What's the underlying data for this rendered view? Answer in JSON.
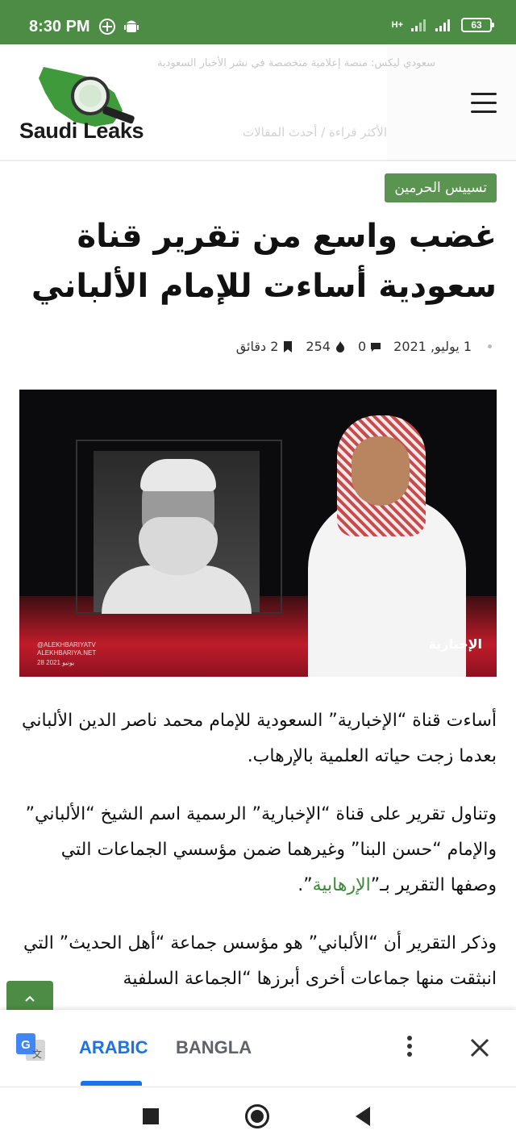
{
  "status_bar": {
    "time": "8:30 PM",
    "network_label": "H+",
    "battery": "63"
  },
  "header": {
    "logo_text": "Saudi Leaks",
    "faded_top_text": "سعودي ليكس: منصة إعلامية متخصصة في نشر الأخبار السعودية",
    "faded_bottom_text": "الأكثر قراءة / أحدث المقالات"
  },
  "article": {
    "category": "تسييس الحرمين",
    "title": "غضب واسع من تقرير قناة سعودية أساءت للإمام الألباني",
    "meta": {
      "date": "1 يوليو, 2021",
      "comments": "0",
      "views": "254",
      "read_time": "2 دقائق"
    },
    "hero_image": {
      "watermark_handle": "@ALEKHBARIYATV",
      "watermark_site": "ALEKHBARIYA.NET",
      "watermark_date": "28 يونيو 2021",
      "channel_logo": "الإخبارية"
    },
    "paragraphs": [
      "أساءت قناة “الإخبارية” السعودية للإمام محمد ناصر الدين الألباني بعدما زجت حياته العلمية بالإرهاب.",
      "وتناول تقرير على قناة “الإخبارية” الرسمية اسم الشيخ “الألباني” والإمام “حسن البنا” وغيرهما ضمن مؤسسي الجماعات التي وصفها التقرير بـ”",
      "وذكر التقرير أن “الألباني” هو مؤسس جماعة “أهل الحديث” التي انبثقت منها جماعات أخرى أبرزها “الجماعة السلفية"
    ],
    "paragraph2_link": "الإرهابية",
    "paragraph2_end": "”."
  },
  "translate_bar": {
    "tab_active": "ARABIC",
    "tab_inactive": "BANGLA"
  },
  "colors": {
    "brand_green": "#4d8c45",
    "link_green": "#3a8a3a",
    "translate_blue": "#1a73e8"
  }
}
